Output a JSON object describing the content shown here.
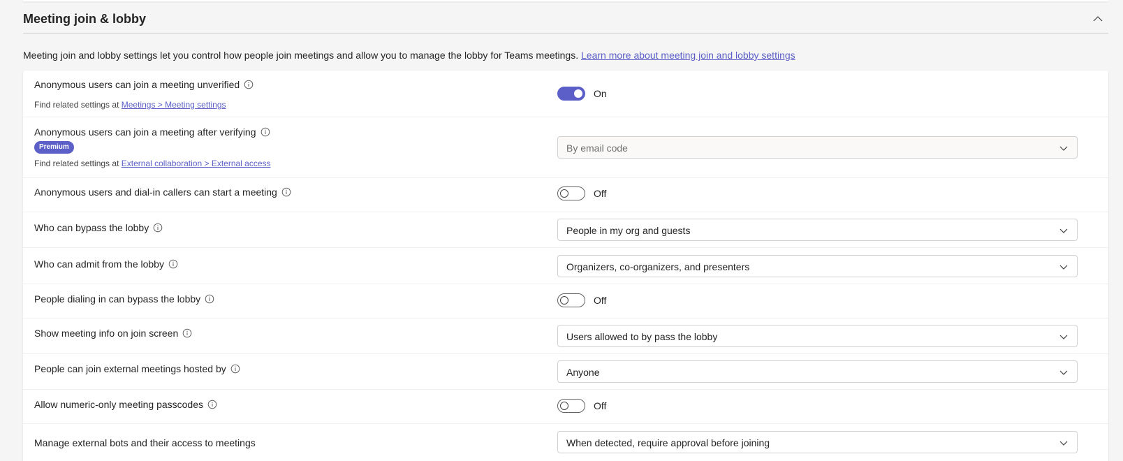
{
  "section": {
    "title": "Meeting join & lobby",
    "description": "Meeting join and lobby settings let you control how people join meetings and allow you to manage the lobby for Teams meetings.",
    "learn_more": "Learn more about meeting join and lobby settings"
  },
  "settings": {
    "anon_unverified": {
      "label": "Anonymous users can join a meeting unverified",
      "state": "On",
      "related_prefix": "Find related settings at",
      "related_link": "Meetings > Meeting settings"
    },
    "anon_verified": {
      "label": "Anonymous users can join a meeting after verifying",
      "badge": "Premium",
      "value": "By email code",
      "related_prefix": "Find related settings at",
      "related_link": "External collaboration > External access"
    },
    "anon_start": {
      "label": "Anonymous users and dial-in callers can start a meeting",
      "state": "Off"
    },
    "bypass_lobby": {
      "label": "Who can bypass the lobby",
      "value": "People in my org and guests"
    },
    "admit_lobby": {
      "label": "Who can admit from the lobby",
      "value": "Organizers, co-organizers, and presenters"
    },
    "dialin_bypass": {
      "label": "People dialing in can bypass the lobby",
      "state": "Off"
    },
    "meeting_info": {
      "label": "Show meeting info on join screen",
      "value": "Users allowed to by pass the lobby"
    },
    "external_meetings": {
      "label": "People can join external meetings hosted by",
      "value": "Anyone"
    },
    "numeric_passcodes": {
      "label": "Allow numeric-only meeting passcodes",
      "state": "Off"
    },
    "external_bots": {
      "label": "Manage external bots and their access to meetings",
      "value": "When detected, require approval before joining"
    }
  },
  "colors": {
    "accent": "#5b5fc7",
    "text": "#242424",
    "border": "#d1d1d1"
  },
  "icons": {
    "info": "info-circle-icon",
    "chevron": "chevron-down-icon",
    "collapse": "chevron-up-icon"
  }
}
